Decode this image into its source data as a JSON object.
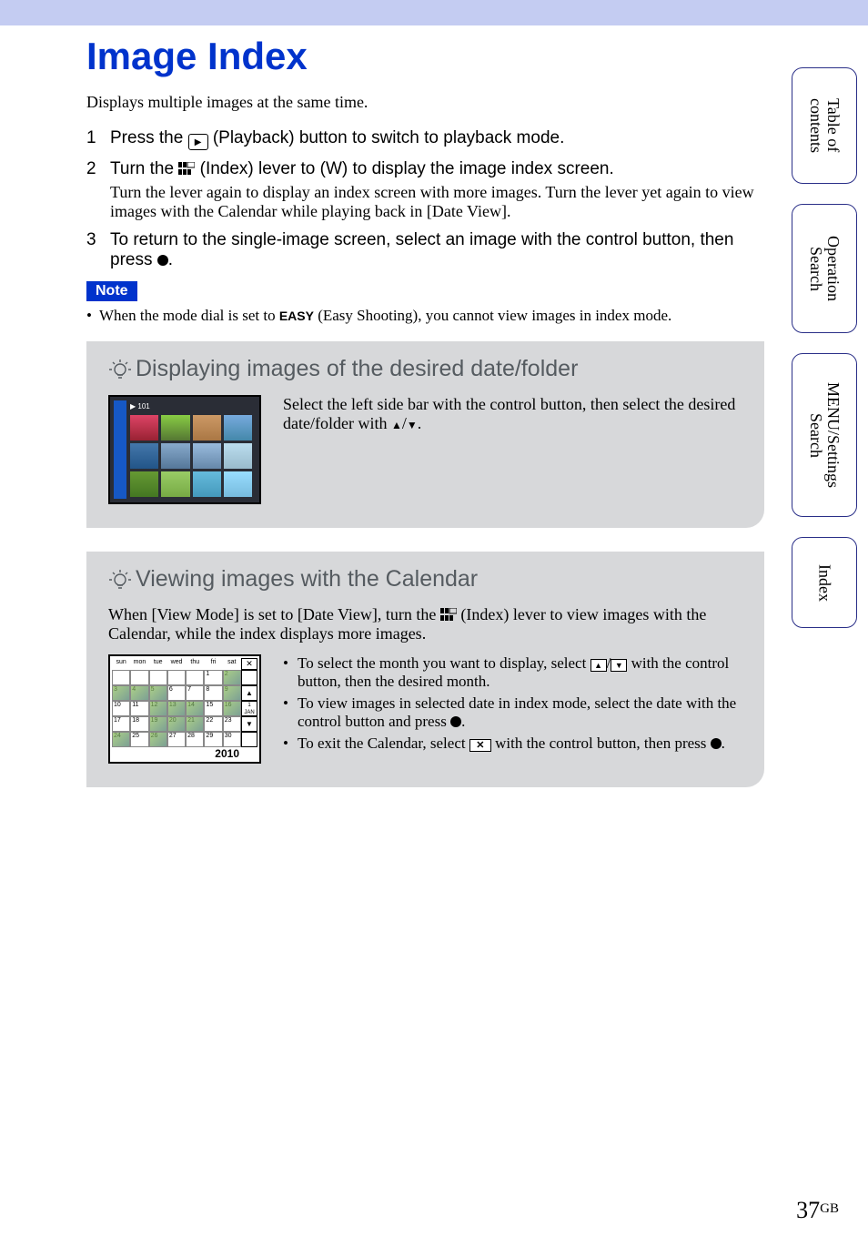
{
  "title": "Image Index",
  "intro": "Displays multiple images at the same time.",
  "steps": {
    "s1_a": "Press the ",
    "s1_b": " (Playback) button to switch to playback mode.",
    "s2_a": "Turn the ",
    "s2_b": " (Index) lever to (W) to display the image index screen.",
    "s2_sub": "Turn the lever again to display an index screen with more images. Turn the lever yet again to view images with the Calendar while playing back in [Date View].",
    "s3_a": "To return to the single-image screen, select an image with the control button, then press ",
    "s3_b": "."
  },
  "note": {
    "badge": "Note",
    "text_a": "When the mode dial is set to ",
    "easy": "EASY",
    "text_b": " (Easy Shooting), you cannot view images in index mode."
  },
  "tip1": {
    "title": "Displaying images of the desired date/folder",
    "text_a": "Select the left side bar with the control button, then select the desired date/folder with ",
    "text_b": "/",
    "text_c": ".",
    "screen_label": "▶ 101"
  },
  "tip2": {
    "title": "Viewing images with the Calendar",
    "lead_a": "When [View Mode] is set to [Date View], turn the ",
    "lead_b": " (Index) lever to view images with the Calendar, while the index displays more images.",
    "bullets": {
      "b1_a": "To select the month you want to display, select ",
      "b1_b": "/",
      "b1_c": " with the control button, then the desired month.",
      "b2_a": "To view images in selected date in index mode, select the date with the control button and press ",
      "b2_b": ".",
      "b3_a": "To exit the Calendar, select ",
      "b3_b": " with the control button, then press ",
      "b3_c": "."
    },
    "calendar": {
      "days": [
        "sun",
        "mon",
        "tue",
        "wed",
        "thu",
        "fri",
        "sat"
      ],
      "side_labels": [
        "✕",
        "▲",
        "1 JAN",
        "▼"
      ],
      "year": "2010"
    }
  },
  "side_tabs": {
    "t1": "Table of contents",
    "t2": "Operation Search",
    "t3": "MENU/Settings Search",
    "t4": "Index"
  },
  "page_number": "37",
  "page_suffix": "GB"
}
